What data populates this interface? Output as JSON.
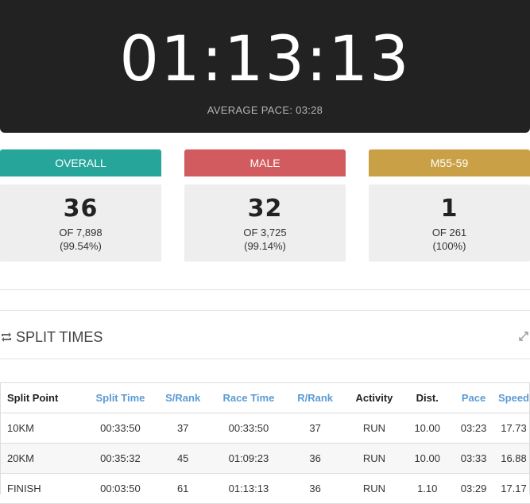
{
  "hero": {
    "time": "01:13:13",
    "pace_label": "AVERAGE PACE: 03:28"
  },
  "ranks": [
    {
      "label": "OVERALL",
      "value": "36",
      "of": "OF 7,898",
      "pct": "(99.54%)",
      "color": "#26a69a"
    },
    {
      "label": "MALE",
      "value": "32",
      "of": "OF 3,725",
      "pct": "(99.14%)",
      "color": "#d15b5e"
    },
    {
      "label": "M55-59",
      "value": "1",
      "of": "OF 261",
      "pct": "(100%)",
      "color": "#c9a046"
    }
  ],
  "splits": {
    "title": "SPLIT TIMES",
    "columns": [
      "Split Point",
      "Split Time",
      "S/Rank",
      "Race Time",
      "R/Rank",
      "Activity",
      "Dist.",
      "Pace",
      "Speed"
    ],
    "rows": [
      [
        "10KM",
        "00:33:50",
        "37",
        "00:33:50",
        "37",
        "RUN",
        "10.00",
        "03:23",
        "17.73"
      ],
      [
        "20KM",
        "00:35:32",
        "45",
        "01:09:23",
        "36",
        "RUN",
        "10.00",
        "03:33",
        "16.88"
      ],
      [
        "FINISH",
        "00:03:50",
        "61",
        "01:13:13",
        "36",
        "RUN",
        "1.10",
        "03:29",
        "17.17"
      ]
    ]
  },
  "colors": {
    "hero_bg": "#222222",
    "link": "#5b9bd5"
  }
}
